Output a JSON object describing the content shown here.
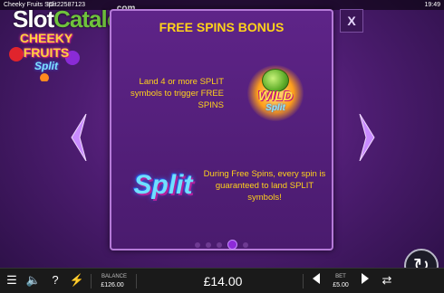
{
  "topbar": {
    "game_name": "Cheeky Fruits Split",
    "game_id": "ID: 22587123",
    "clock": "19:49"
  },
  "watermark": {
    "part1": "Slot",
    "part2": "Catalog",
    "part3": ".com"
  },
  "logo": {
    "line1": "CHEEKY",
    "line2": "FRUITS",
    "line3": "Split"
  },
  "panel": {
    "title": "FREE SPINS BONUS",
    "text1": "Land 4 or more SPLIT symbols to trigger FREE SPINS",
    "text2": "During Free Spins, every spin is guaranteed to land SPLIT symbols!",
    "wild_line1": "WILD",
    "wild_line2": "Split",
    "split_logo": "Split",
    "pages_total": 5,
    "page_active": 4
  },
  "controls": {
    "close_label": "X",
    "menu_icon": "menu-icon",
    "sound_icon": "sound-icon",
    "help_label": "?",
    "turbo_icon": "lightning-icon"
  },
  "balance": {
    "label": "BALANCE",
    "value": "£126.00"
  },
  "win": {
    "value": "£14.00"
  },
  "bet": {
    "label": "BET",
    "value": "£5.00"
  },
  "colors": {
    "accent_yellow": "#ffd21a",
    "panel_border": "#b57ad8"
  }
}
